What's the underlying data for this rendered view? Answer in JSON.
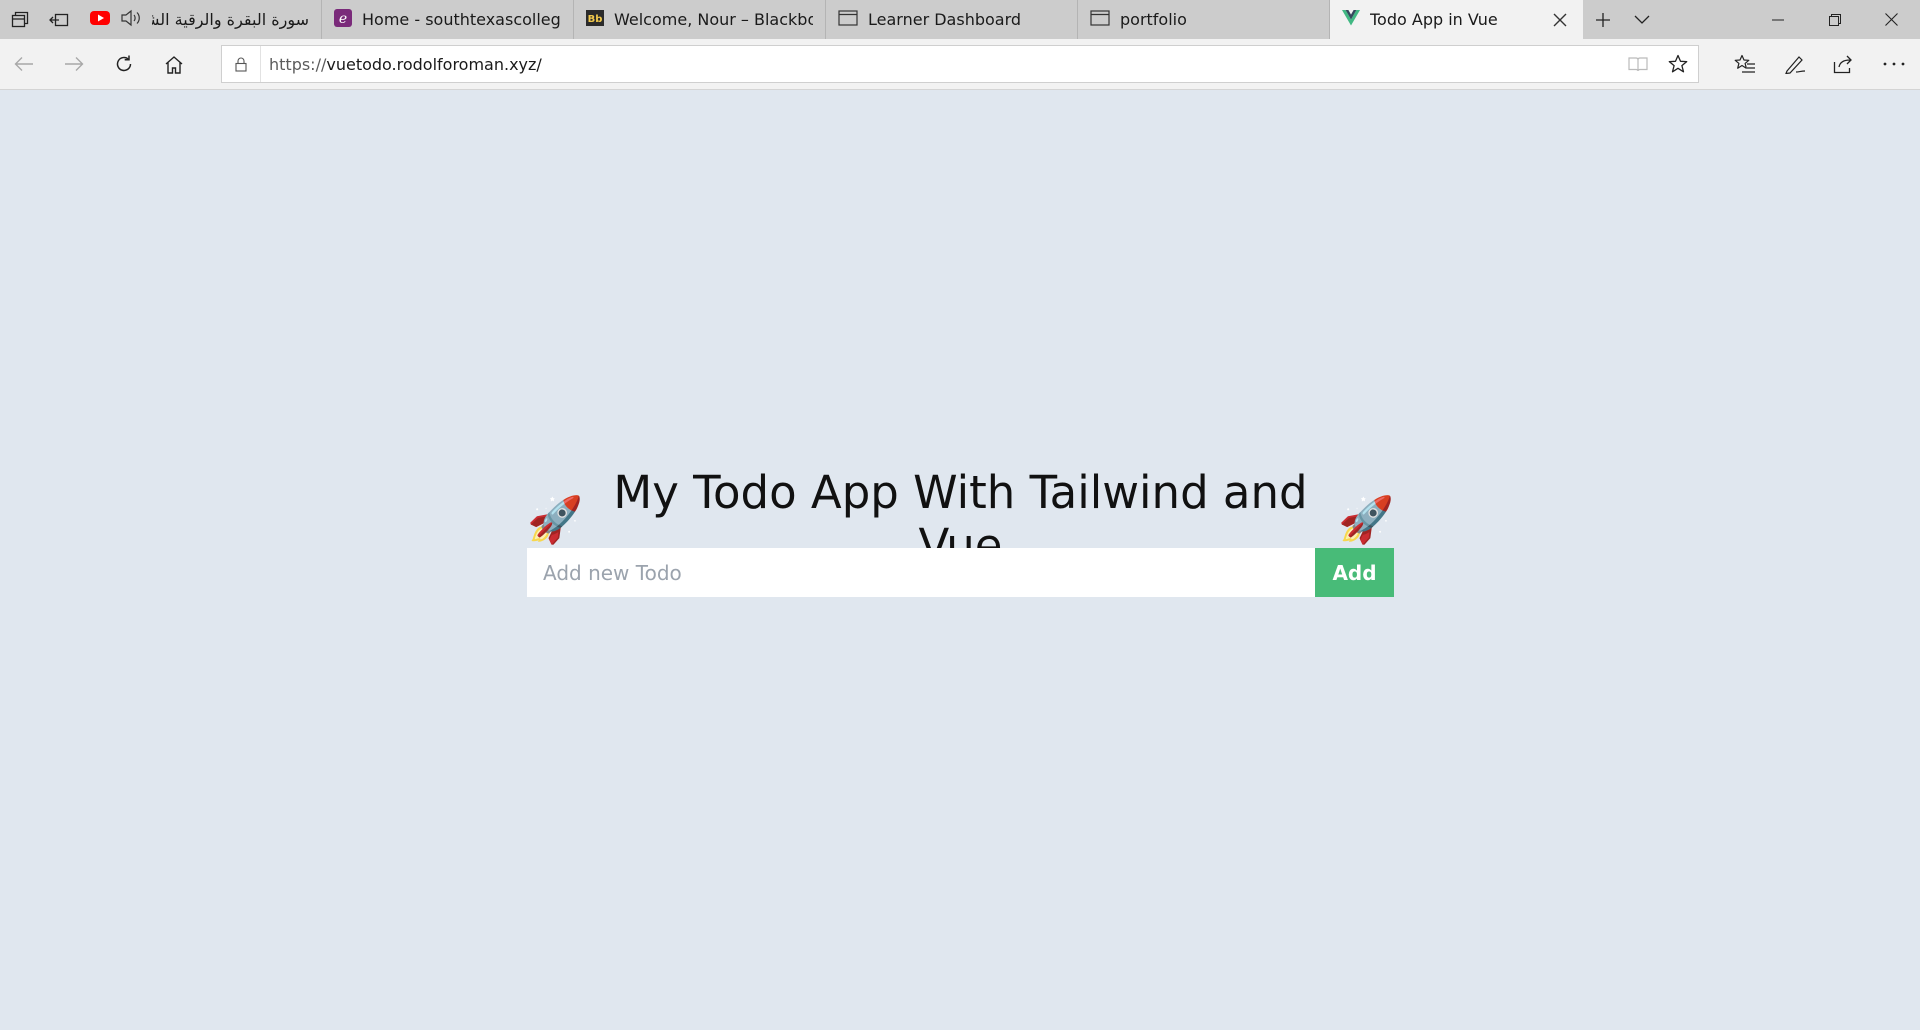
{
  "tabs": [
    {
      "title": "سورة البقرة والرقية الشرع",
      "icon": "youtube-icon",
      "audio_icon": "speaker-icon"
    },
    {
      "title": "Home - southtexascollege.e",
      "icon": "e-icon"
    },
    {
      "title": "Welcome, Nour – Blackboar",
      "icon": "blackboard-icon"
    },
    {
      "title": "Learner Dashboard",
      "icon": "page-icon"
    },
    {
      "title": "portfolio",
      "icon": "page-icon"
    },
    {
      "title": "Todo App in Vue",
      "icon": "vue-icon",
      "active": true
    }
  ],
  "address_bar": {
    "scheme": "https://",
    "host": "vuetodo.rodolforoman.xyz/"
  },
  "app": {
    "title": "My Todo App With Tailwind and Vue",
    "emoji": "🚀",
    "input_placeholder": "Add new Todo",
    "input_value": "",
    "add_label": "Add"
  },
  "colors": {
    "page_bg": "#e0e7ef",
    "add_button": "#48bb78",
    "youtube_red": "#ff0000",
    "vue_green": "#41b883"
  }
}
